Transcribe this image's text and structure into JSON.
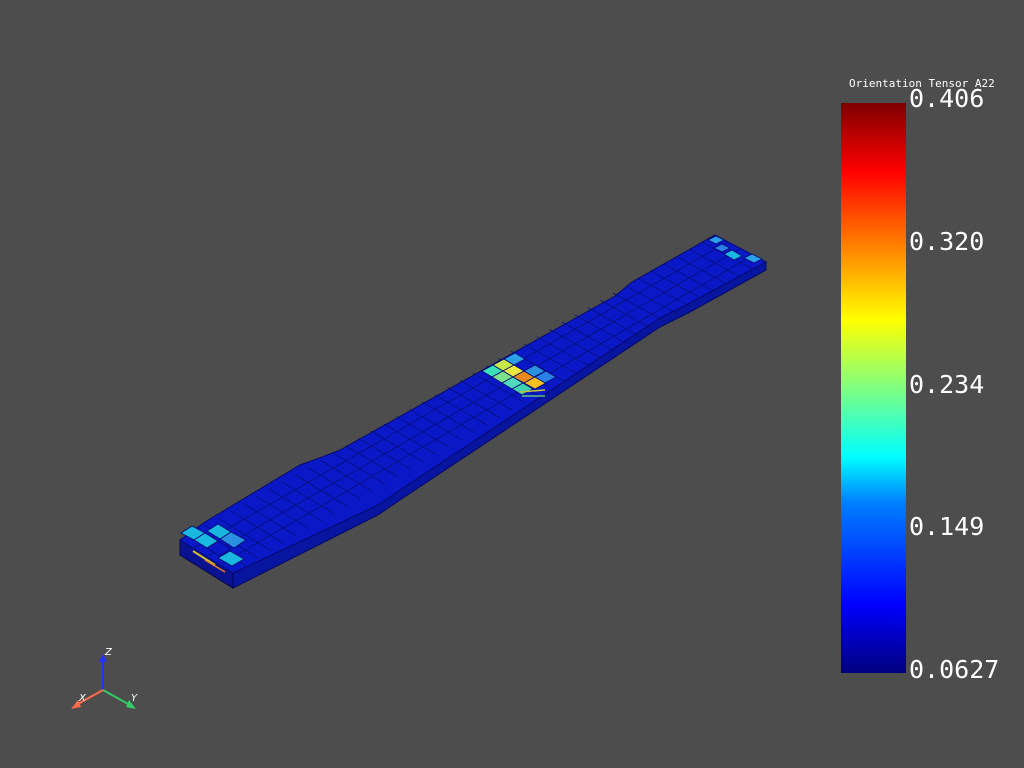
{
  "colorbar": {
    "title": "Orientation Tensor A22",
    "ticks": [
      "0.406",
      "0.320",
      "0.234",
      "0.149",
      "0.0627"
    ],
    "min": 0.0627,
    "max": 0.406,
    "colormap": "jet"
  },
  "axes": {
    "x_label": "X",
    "y_label": "Y",
    "z_label": "Z",
    "x_color": "#ff6a4a",
    "y_color": "#33cc66",
    "z_color": "#2233ff"
  },
  "scene": {
    "background": "#4d4d4d",
    "object": "dogbone tensile specimen mesh",
    "base_color": "#0a18c8",
    "highlight_colors": [
      "#19b8e0",
      "#f2c020",
      "#e88a1a",
      "#7be08a",
      "#2aa0e8"
    ]
  }
}
